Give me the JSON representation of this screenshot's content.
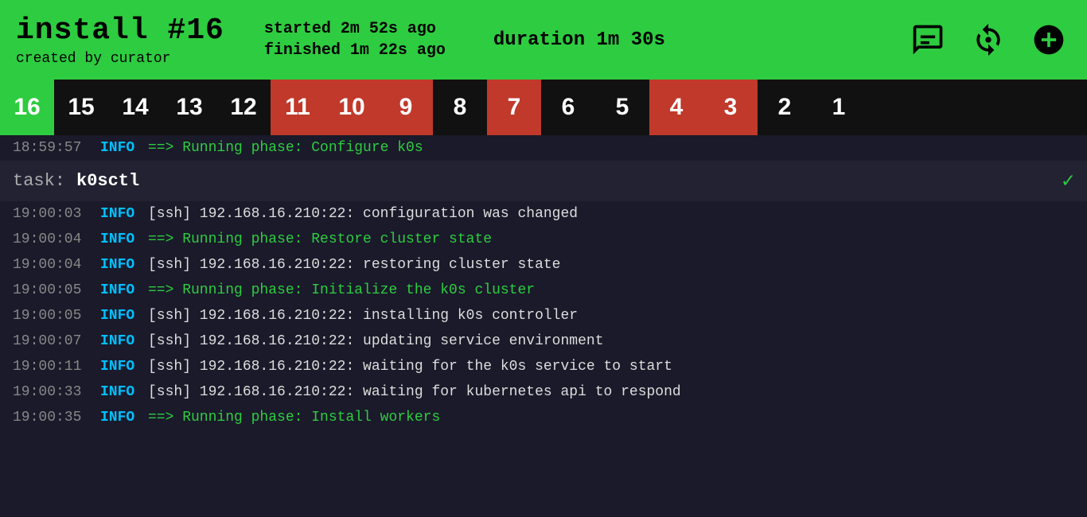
{
  "header": {
    "title": "install #16",
    "created_by": "created by curator",
    "started": "started 2m 52s ago",
    "finished": "finished 1m 22s ago",
    "duration": "duration 1m 30s"
  },
  "icons": {
    "comment": "comment-icon",
    "refresh": "refresh-icon",
    "add": "add-icon"
  },
  "steps": [
    {
      "num": "16",
      "style": "active"
    },
    {
      "num": "15",
      "style": "normal"
    },
    {
      "num": "14",
      "style": "normal"
    },
    {
      "num": "13",
      "style": "normal"
    },
    {
      "num": "12",
      "style": "normal"
    },
    {
      "num": "11",
      "style": "error"
    },
    {
      "num": "10",
      "style": "error"
    },
    {
      "num": "9",
      "style": "error"
    },
    {
      "num": "8",
      "style": "normal"
    },
    {
      "num": "7",
      "style": "error"
    },
    {
      "num": "6",
      "style": "normal"
    },
    {
      "num": "5",
      "style": "normal"
    },
    {
      "num": "4",
      "style": "error"
    },
    {
      "num": "3",
      "style": "error"
    },
    {
      "num": "2",
      "style": "normal"
    },
    {
      "num": "1",
      "style": "normal"
    }
  ],
  "log_lines": [
    {
      "time": "18:59:57",
      "level": "INFO",
      "msg": "==> Running phase: Configure k0s",
      "phase": true
    },
    {
      "time": "",
      "level": "",
      "msg": "",
      "task": true,
      "task_label": "task:",
      "task_name": "k0sctl"
    },
    {
      "time": "19:00:03",
      "level": "INFO",
      "msg": "[ssh] 192.168.16.210:22: configuration was changed",
      "phase": false
    },
    {
      "time": "19:00:04",
      "level": "INFO",
      "msg": "==> Running phase: Restore cluster state",
      "phase": true
    },
    {
      "time": "19:00:04",
      "level": "INFO",
      "msg": "[ssh] 192.168.16.210:22: restoring cluster state",
      "phase": false
    },
    {
      "time": "19:00:05",
      "level": "INFO",
      "msg": "==> Running phase: Initialize the k0s cluster",
      "phase": true
    },
    {
      "time": "19:00:05",
      "level": "INFO",
      "msg": "[ssh] 192.168.16.210:22: installing k0s controller",
      "phase": false
    },
    {
      "time": "19:00:07",
      "level": "INFO",
      "msg": "[ssh] 192.168.16.210:22: updating service environment",
      "phase": false
    },
    {
      "time": "19:00:11",
      "level": "INFO",
      "msg": "[ssh] 192.168.16.210:22: waiting for the k0s service to start",
      "phase": false
    },
    {
      "time": "19:00:33",
      "level": "INFO",
      "msg": "[ssh] 192.168.16.210:22: waiting for kubernetes api to respond",
      "phase": false
    },
    {
      "time": "19:00:35",
      "level": "INFO",
      "msg": "==> Running phase: Install workers",
      "phase": true
    }
  ]
}
